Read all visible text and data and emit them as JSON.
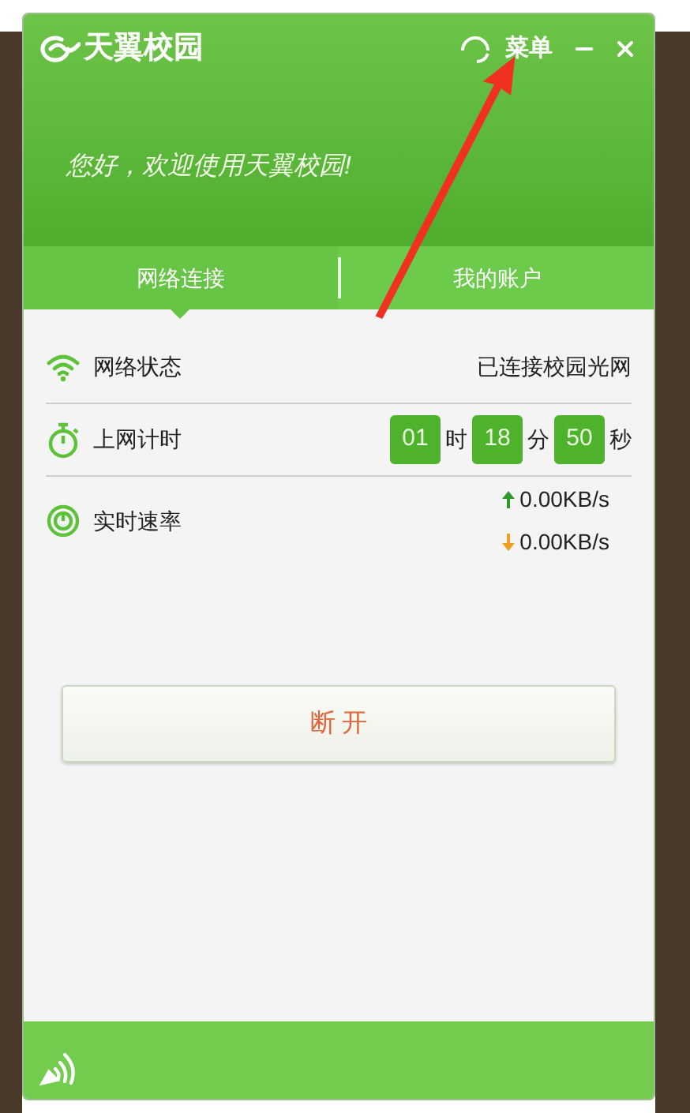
{
  "header": {
    "logo": "天翼校园",
    "menu": "菜单",
    "greeting": "您好，欢迎使用天翼校园!"
  },
  "tabs": [
    {
      "label": "网络连接",
      "selected": true
    },
    {
      "label": "我的账户",
      "selected": false
    }
  ],
  "rows": [
    {
      "kind": "status",
      "label": "网络状态",
      "value": "已连接校园光网"
    },
    {
      "kind": "timer",
      "label": "上网计时",
      "parts": [
        {
          "value": "01",
          "unit": "时"
        },
        {
          "value": "18",
          "unit": "分"
        },
        {
          "value": "50",
          "unit": "秒"
        }
      ]
    },
    {
      "kind": "speed",
      "label": "实时速率",
      "up": "0.00KB/s",
      "down": "0.00KB/s"
    }
  ],
  "disconnect_button": "断 开"
}
